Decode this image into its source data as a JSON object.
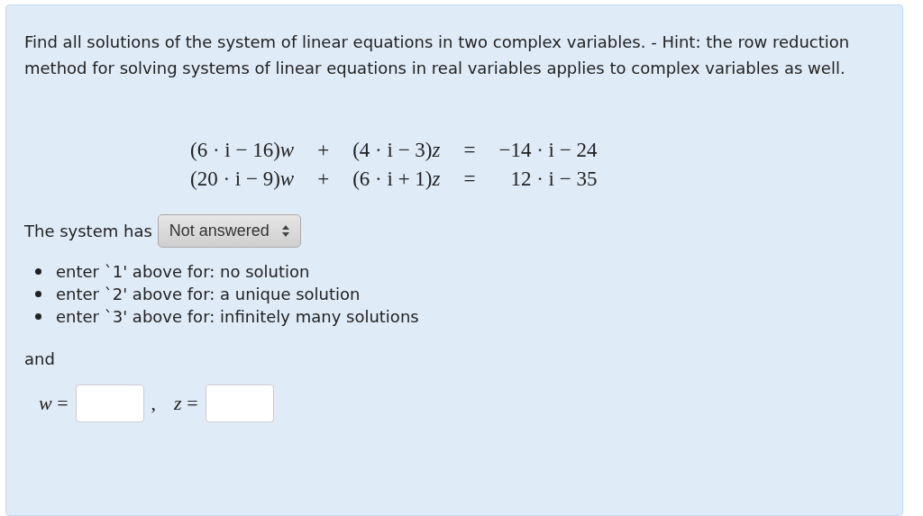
{
  "question": {
    "prompt": "Find all solutions of the system of linear equations in two complex variables. - Hint: the row reduction method for solving systems of linear equations in real variables applies to complex variables as well.",
    "equations": [
      {
        "left": "(6 · i − 16)*w*",
        "plus": "+",
        "middle": "(4 · i − 3)*z*",
        "equals": "=",
        "right": "−14 · i − 24"
      },
      {
        "left": "(20 · i − 9)*w*",
        "plus": "+",
        "middle": "(6 · i + 1)*z*",
        "equals": "=",
        "right": "12 · i − 35"
      }
    ],
    "system_label": "The system has",
    "select": {
      "value": "Not answered"
    },
    "options": [
      "enter `1' above for: no solution",
      "enter `2' above for: a unique solution",
      "enter `3' above for: infinitely many solutions"
    ],
    "and_label": "and",
    "answers": [
      {
        "label": "*w* ="
      },
      {
        "label": "*z* ="
      }
    ],
    "separator": ","
  }
}
